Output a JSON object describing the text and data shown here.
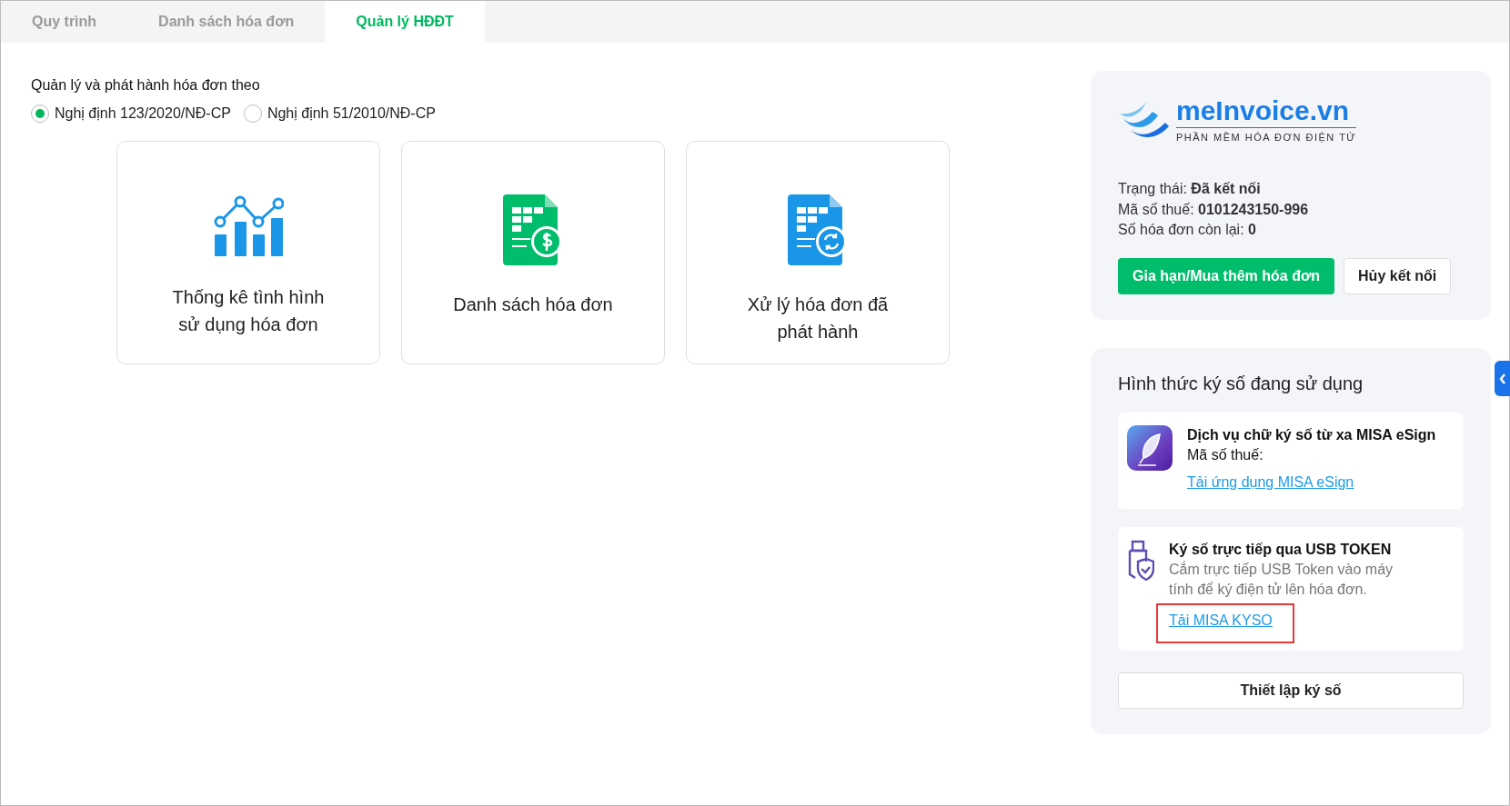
{
  "tabs": [
    {
      "label": "Quy trình",
      "selected": false
    },
    {
      "label": "Danh sách hóa đơn",
      "selected": false
    },
    {
      "label": "Quản lý HĐĐT",
      "selected": true
    }
  ],
  "decree": {
    "title": "Quản lý và phát hành hóa đơn theo",
    "options": [
      {
        "label": "Nghị định 123/2020/NĐ-CP",
        "selected": true
      },
      {
        "label": "Nghị định 51/2010/NĐ-CP",
        "selected": false
      }
    ]
  },
  "cards": [
    {
      "kind": "chart",
      "label": "Thống kê tình hình sử dụng hóa đơn"
    },
    {
      "kind": "money",
      "label": "Danh sách hóa đơn"
    },
    {
      "kind": "exchange",
      "label": "Xử lý hóa đơn đã phát hành"
    }
  ],
  "connection": {
    "logo_name": "meInvoice.vn",
    "logo_tagline": "PHẦN MỀM HÓA ĐƠN ĐIỆN TỬ",
    "info": [
      {
        "label": "Trạng thái:",
        "value": "Đã kết nối"
      },
      {
        "label": "Mã số thuế:",
        "value": "0101243150-996"
      },
      {
        "label": "Số hóa đơn còn lại:",
        "value": "0"
      }
    ],
    "primary_button": "Gia hạn/Mua thêm hóa đơn",
    "secondary_button": "Hủy kết nối"
  },
  "signing": {
    "title": "Hình thức ký số đang sử dụng",
    "methods": [
      {
        "kind": "esign",
        "title": "Dịch vụ chữ ký số từ xa MISA eSign",
        "subtitle": "Mã số thuế:",
        "link": "Tải ứng dụng MISA eSign",
        "highlighted": false
      },
      {
        "kind": "usb",
        "title": "Ký số trực tiếp qua USB TOKEN",
        "description": "Cắm trực tiếp USB Token vào máy tính để ký điện tử lên hóa đơn.",
        "link": "Tải MISA KYSO",
        "highlighted": true
      }
    ],
    "setup_button": "Thiết lập ký số"
  }
}
